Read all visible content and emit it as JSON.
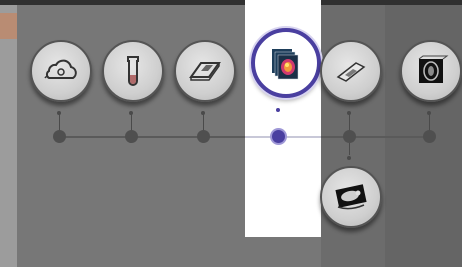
{
  "workflow": {
    "steps": [
      {
        "id": "cloud-upload",
        "icon": "cloud-mouse-icon",
        "active": false
      },
      {
        "id": "sample-tube",
        "icon": "test-tube-icon",
        "active": false
      },
      {
        "id": "tissue-slide",
        "icon": "slide-block-icon",
        "active": false
      },
      {
        "id": "image-stack",
        "icon": "image-stack-icon",
        "active": true
      },
      {
        "id": "microscope-slide",
        "icon": "microscope-slide-icon",
        "active": false
      },
      {
        "id": "3d-scan",
        "icon": "3d-volume-icon",
        "active": false
      }
    ],
    "branch": {
      "id": "mouse-scan",
      "icon": "mouse-scan-icon",
      "parent": "microscope-slide"
    }
  },
  "colors": {
    "accent": "#4a3fa0",
    "background": "#777777",
    "highlight": "#ffffff",
    "node_fill": "#d0d0d0"
  }
}
